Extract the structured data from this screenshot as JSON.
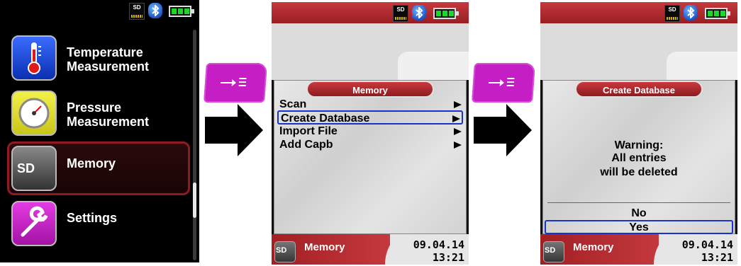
{
  "status": {
    "sd_label": "SD"
  },
  "main_menu": {
    "items": [
      {
        "label_line1": "Temperature",
        "label_line2": "Measurement",
        "icon": "thermometer-icon"
      },
      {
        "label_line1": "Pressure",
        "label_line2": "Measurement",
        "icon": "pressure-gauge-icon"
      },
      {
        "label_line1": "Memory",
        "label_line2": "",
        "icon": "sd-card-icon",
        "icon_text": "SD"
      },
      {
        "label_line1": "Settings",
        "label_line2": "",
        "icon": "wrench-icon"
      }
    ],
    "selected_index": 2
  },
  "memory_screen": {
    "title": "Memory",
    "items": [
      {
        "label": "Scan"
      },
      {
        "label": "Create Database"
      },
      {
        "label": "Import File"
      },
      {
        "label": "Add Capb"
      }
    ],
    "highlighted_index": 1
  },
  "create_db_screen": {
    "title": "Create Database",
    "warning_line1": "Warning:",
    "warning_line2": "All entries",
    "warning_line3": "will be deleted",
    "option_no": "No",
    "option_yes": "Yes",
    "selected_option": "Yes"
  },
  "footer": {
    "title": "Memory",
    "icon_text": "SD",
    "date": "09.04.14",
    "time": "13:21"
  },
  "colors": {
    "accent_red": "#a21f24",
    "button_magenta": "#c41ec4",
    "highlight_blue": "#1833c8",
    "battery_green": "#20d62a"
  }
}
